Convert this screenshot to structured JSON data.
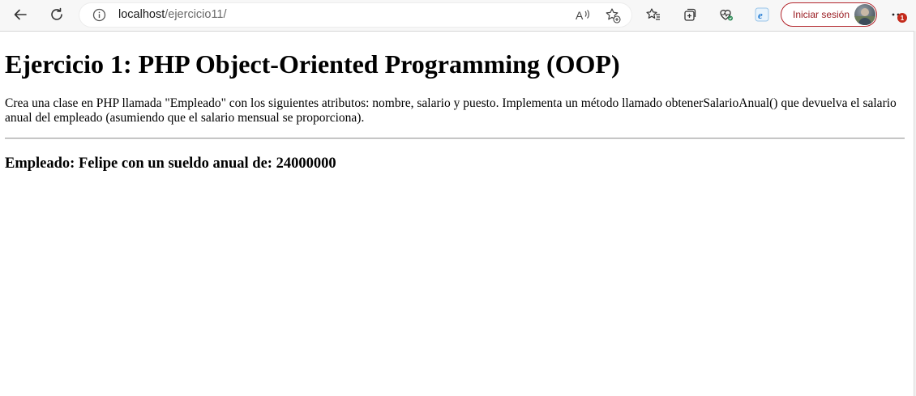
{
  "browser": {
    "url_host": "localhost",
    "url_path": "/ejercicio11/",
    "signin_label": "Iniciar sesión",
    "notification_count": "1",
    "icons": [
      "back-icon",
      "refresh-icon",
      "info-icon",
      "read-aloud-icon",
      "add-favorite-icon",
      "favorites-icon",
      "collections-icon",
      "browser-essentials-icon",
      "edge-icon",
      "more-icon"
    ]
  },
  "page": {
    "title": "Ejercicio 1: PHP Object-Oriented Programming (OOP)",
    "description": "Crea una clase en PHP llamada \"Empleado\" con los siguientes atributos: nombre, salario y puesto. Implementa un método llamado obtenerSalarioAnual() que devuelva el salario anual del empleado (asumiendo que el salario mensual se proporciona).",
    "result": "Empleado: Felipe con un sueldo anual de: 24000000"
  },
  "colors": {
    "signin_border": "#b3262d",
    "badge": "#c42b1c"
  }
}
